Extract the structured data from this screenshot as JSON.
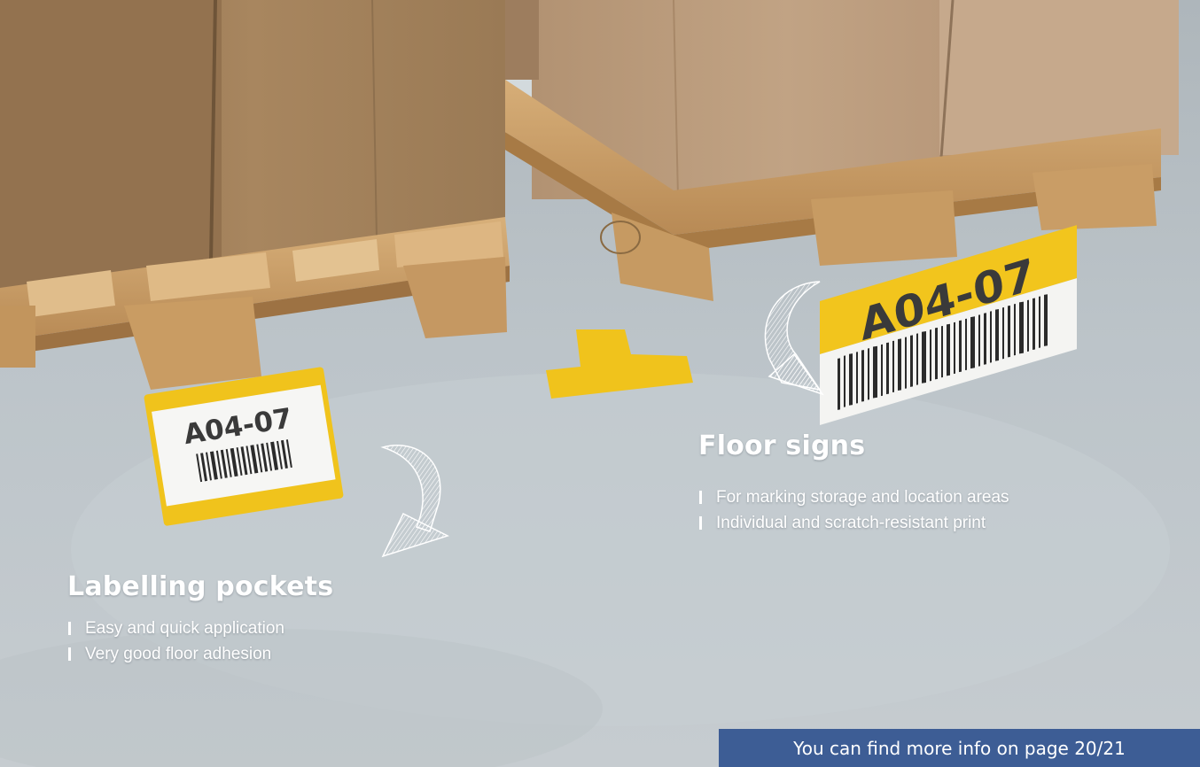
{
  "labelling_pockets": {
    "title": "Labelling pockets",
    "features": [
      "Easy and quick application",
      "Very good floor adhesion"
    ]
  },
  "floor_signs": {
    "title": "Floor signs",
    "features": [
      "For marking storage and location areas",
      "Individual and scratch-resistant print"
    ]
  },
  "product_labels": {
    "pocket_code": "A04-07",
    "sign_code": "A04-07"
  },
  "info_banner": {
    "text": "You can find more info on page 20/21"
  },
  "colors": {
    "accent_yellow": "#f2c51d",
    "banner_blue": "#3d5d95",
    "floor_grey": "#bcc4c9",
    "cardboard": "#a8865f",
    "pallet_wood": "#c89a63"
  }
}
